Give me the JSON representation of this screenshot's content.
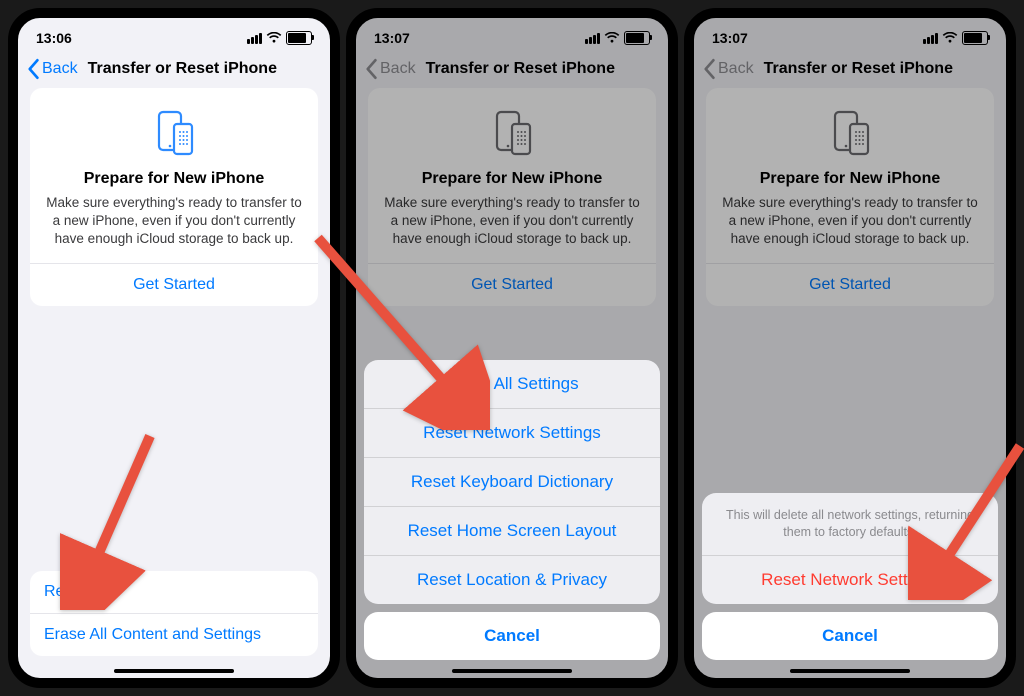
{
  "screens": [
    {
      "time": "13:06",
      "back_label": "Back",
      "title": "Transfer or Reset iPhone",
      "hero_title": "Prepare for New iPhone",
      "hero_text": "Make sure everything's ready to transfer to a new iPhone, even if you don't currently have enough iCloud storage to back up.",
      "get_started": "Get Started",
      "rows": [
        "Reset",
        "Erase All Content and Settings"
      ]
    },
    {
      "time": "13:07",
      "back_label": "Back",
      "title": "Transfer or Reset iPhone",
      "hero_title": "Prepare for New iPhone",
      "hero_text": "Make sure everything's ready to transfer to a new iPhone, even if you don't currently have enough iCloud storage to back up.",
      "get_started": "Get Started",
      "sheet_options": [
        "Reset All Settings",
        "Reset Network Settings",
        "Reset Keyboard Dictionary",
        "Reset Home Screen Layout",
        "Reset Location & Privacy"
      ],
      "cancel": "Cancel"
    },
    {
      "time": "13:07",
      "back_label": "Back",
      "title": "Transfer or Reset iPhone",
      "hero_title": "Prepare for New iPhone",
      "hero_text": "Make sure everything's ready to transfer to a new iPhone, even if you don't currently have enough iCloud storage to back up.",
      "get_started": "Get Started",
      "confirm_msg": "This will delete all network settings, returning them to factory defaults.",
      "confirm_action": "Reset Network Settings",
      "cancel": "Cancel"
    }
  ]
}
